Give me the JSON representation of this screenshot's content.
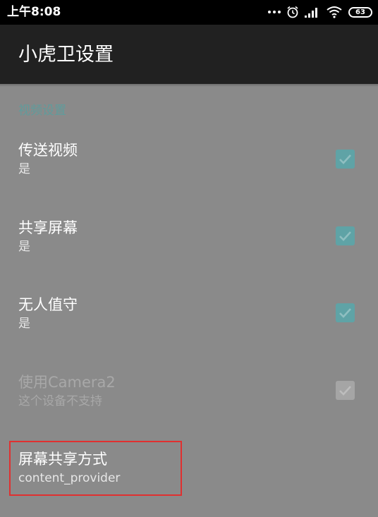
{
  "status_bar": {
    "time": "上午8:08",
    "battery": "63",
    "icons": [
      "more-dots-icon",
      "alarm-icon",
      "signal-icon",
      "wifi-icon",
      "battery-icon"
    ]
  },
  "app_bar": {
    "title": "小虎卫设置"
  },
  "category": {
    "label": "视频设置",
    "color": "#5f9c9c"
  },
  "preferences": [
    {
      "title": "传送视频",
      "summary": "是",
      "checked": true,
      "enabled": true
    },
    {
      "title": "共享屏幕",
      "summary": "是",
      "checked": true,
      "enabled": true
    },
    {
      "title": "无人值守",
      "summary": "是",
      "checked": true,
      "enabled": true
    },
    {
      "title": "使用Camera2",
      "summary": "这个设备不支持",
      "checked": true,
      "enabled": false
    },
    {
      "title": "屏幕共享方式",
      "summary": "content_provider",
      "highlighted": true
    }
  ],
  "colors": {
    "accent": "#5fa3a6",
    "background": "#8a8a8a",
    "app_bar": "#212121",
    "highlight_border": "#e03030"
  }
}
